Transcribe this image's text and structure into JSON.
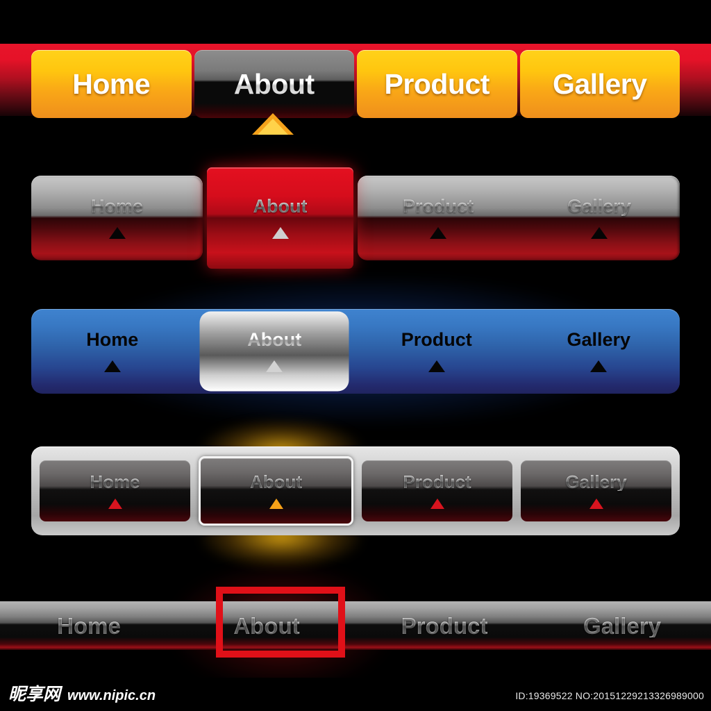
{
  "meta": {
    "background_color": "#000000",
    "accent_yellow": "#ffc60f",
    "accent_red": "#e01018",
    "accent_blue": "#3878c3",
    "accent_silver": "#d6d6d6"
  },
  "nav_sets": [
    {
      "id": "yellow-tabs",
      "style": "yellow-orange-tabs-on-red-strip",
      "active_index": 1,
      "items": [
        {
          "label": "Home"
        },
        {
          "label": "About"
        },
        {
          "label": "Product"
        },
        {
          "label": "Gallery"
        }
      ],
      "indicator": {
        "name": "up-arrow-icon",
        "color": "#f5a21b"
      }
    },
    {
      "id": "silver-red-bar",
      "style": "silver-to-dark-red-bar-with-red-active-tab",
      "active_index": 1,
      "items": [
        {
          "label": "Home",
          "arrow_color": "#050505"
        },
        {
          "label": "About",
          "arrow_color": "#cfcfcf"
        },
        {
          "label": "Product",
          "arrow_color": "#050505"
        },
        {
          "label": "Gallery",
          "arrow_color": "#050505"
        }
      ]
    },
    {
      "id": "blue-bar",
      "style": "blue-gradient-bar-with-silver-outlined-active",
      "active_index": 1,
      "items": [
        {
          "label": "Home",
          "arrow_color": "#050505"
        },
        {
          "label": "About",
          "arrow_color": "#d2d2d2"
        },
        {
          "label": "Product",
          "arrow_color": "#050505"
        },
        {
          "label": "Gallery",
          "arrow_color": "#050505"
        }
      ]
    },
    {
      "id": "silver-bar",
      "style": "silver-bar-with-dark-inset-buttons",
      "active_index": 1,
      "items": [
        {
          "label": "Home",
          "arrow_color": "#d8141f"
        },
        {
          "label": "About",
          "arrow_color": "#f5a118"
        },
        {
          "label": "Product",
          "arrow_color": "#d8141f"
        },
        {
          "label": "Gallery",
          "arrow_color": "#d8141f"
        }
      ]
    },
    {
      "id": "dark-strip-bar",
      "style": "full-width-dark-strip-with-red-selection-box",
      "active_index": 1,
      "items": [
        {
          "label": "Home"
        },
        {
          "label": "About"
        },
        {
          "label": "Product"
        },
        {
          "label": "Gallery"
        }
      ],
      "selection_box_color": "#e01018"
    }
  ],
  "watermark": {
    "site_cn": "昵享网",
    "site_url": "www.nipic.cn",
    "id_text": "ID:19369522 NO:20151229213326989000"
  }
}
